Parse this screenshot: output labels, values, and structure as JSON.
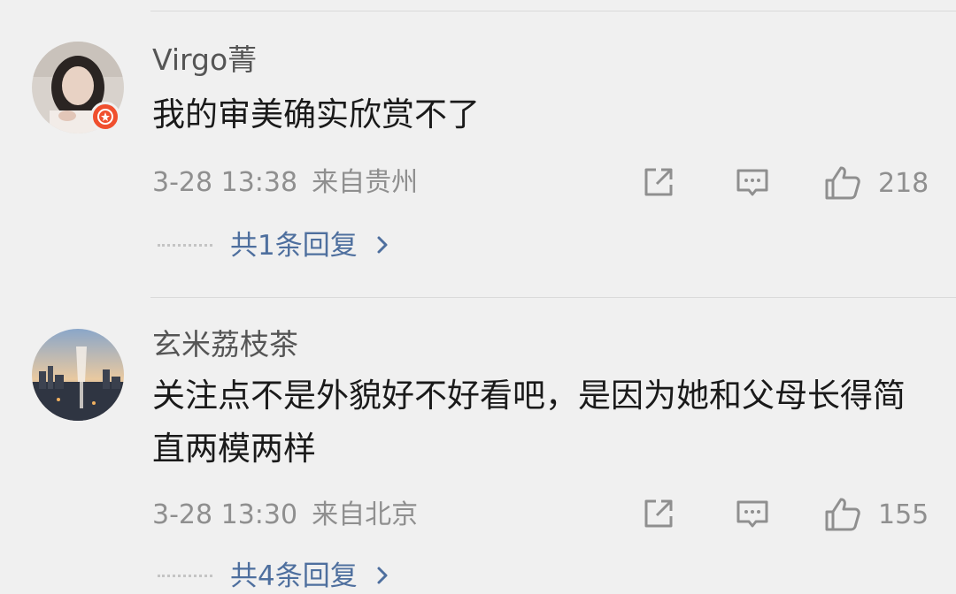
{
  "comments": [
    {
      "username": "Virgo菁",
      "text": "我的审美确实欣赏不了",
      "timestamp": "3-28 13:38",
      "location": "来自贵州",
      "likes": "218",
      "replies_label": "共1条回复",
      "avatar_badge_color": "#f04f2e"
    },
    {
      "username": "玄米荔枝茶",
      "text": "关注点不是外貌好不好看吧，是因为她和父母长得简直两模两样",
      "timestamp": "3-28 13:30",
      "location": "来自北京",
      "likes": "155",
      "replies_label": "共4条回复"
    }
  ],
  "icons": {
    "share": "share-icon",
    "reply": "comment-icon",
    "like": "thumbs-up-icon",
    "chevron": "chevron-right-icon"
  },
  "colors": {
    "link": "#4e6f9e",
    "meta": "#8f8f8f",
    "text": "#1a1a1a"
  }
}
